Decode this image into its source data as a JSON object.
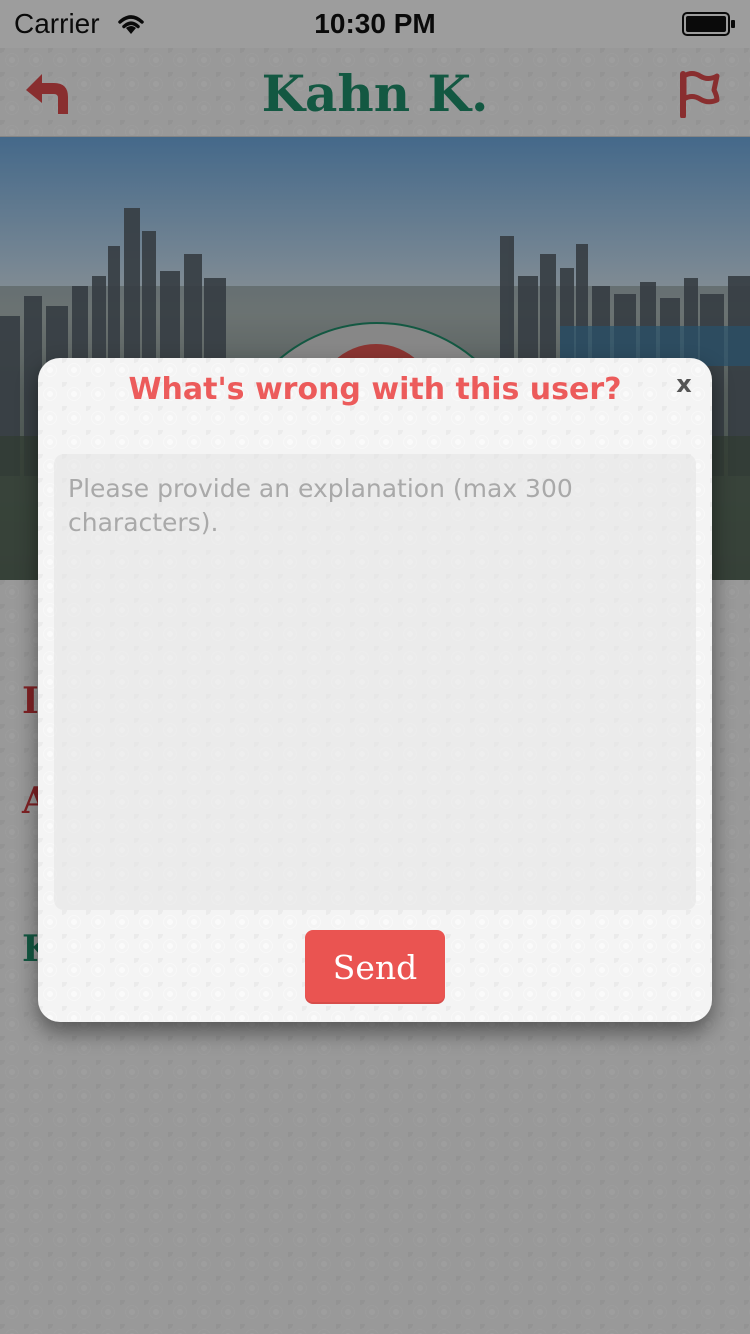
{
  "status_bar": {
    "carrier": "Carrier",
    "time": "10:30 PM",
    "wifi_icon": "wifi-icon",
    "battery_icon": "battery-icon"
  },
  "nav": {
    "title": "Kahn K.",
    "back_icon": "back-arrow-icon",
    "flag_icon": "flag-icon"
  },
  "profile": {
    "avatar_icon": "user-silhouette-icon",
    "peek_items": [
      "I",
      "A",
      "K"
    ]
  },
  "report_modal": {
    "title": "What's wrong with this user?",
    "close_label": "x",
    "explanation_placeholder": "Please provide an explanation (max 300 characters).",
    "explanation_value": "",
    "send_label": "Send"
  },
  "colors": {
    "accent_red": "#ea5451",
    "title_red": "#ec5b5b",
    "name_green": "#1e8a68"
  }
}
